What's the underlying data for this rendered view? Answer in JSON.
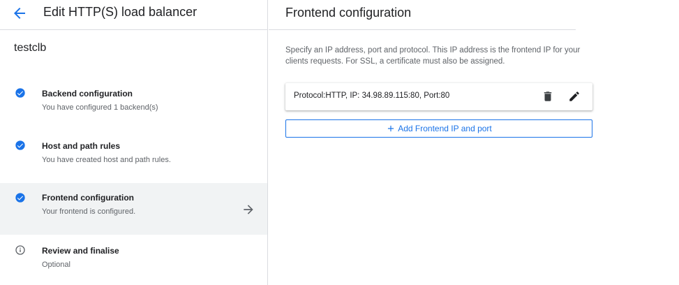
{
  "header": {
    "title": "Edit HTTP(S) load balancer"
  },
  "load_balancer": {
    "name": "testclb"
  },
  "steps": [
    {
      "title": "Backend configuration",
      "subtitle": "You have configured 1 backend(s)",
      "status": "complete"
    },
    {
      "title": "Host and path rules",
      "subtitle": "You have created host and path rules.",
      "status": "complete"
    },
    {
      "title": "Frontend configuration",
      "subtitle": "Your frontend is configured.",
      "status": "complete",
      "active": true
    },
    {
      "title": "Review and finalise",
      "subtitle": "Optional",
      "status": "info"
    }
  ],
  "frontend": {
    "title": "Frontend configuration",
    "description": "Specify an IP address, port and protocol. This IP address is the frontend IP for your clients requests. For SSL, a certificate must also be assigned.",
    "entries": [
      {
        "text": "Protocol:HTTP, IP: 34.98.89.115:80, Port:80"
      }
    ],
    "add_button_label": "Add Frontend IP and port"
  },
  "colors": {
    "accent": "#1a73e8",
    "active_bg": "#f1f3f4",
    "check": "#1a73e8",
    "info": "#5f6368"
  },
  "icons": {
    "back": "arrow-back-icon",
    "check": "check-circle-icon",
    "info": "info-icon",
    "forward": "arrow-forward-icon",
    "delete": "trash-icon",
    "edit": "pencil-icon",
    "add": "plus-icon"
  }
}
